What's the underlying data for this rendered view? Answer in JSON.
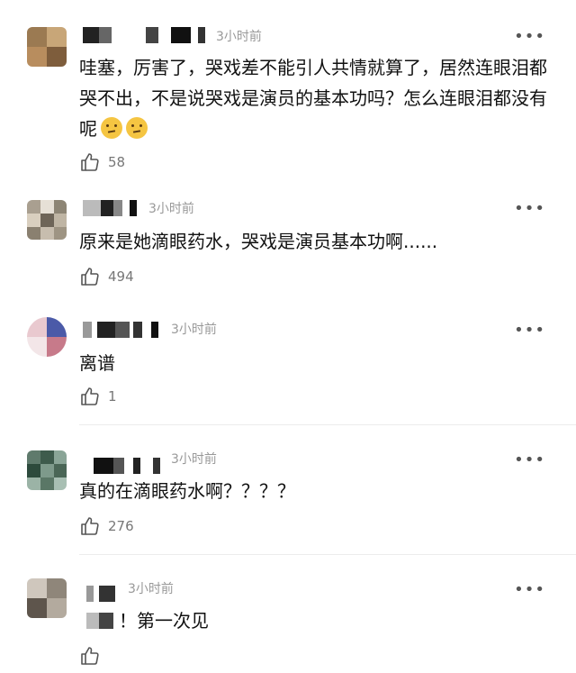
{
  "comments": [
    {
      "time": "3小时前",
      "text": "哇塞，厉害了，哭戏差不能引人共情就算了，居然连眼泪都哭不出，不是说哭戏是演员的基本功吗？怎么连眼泪都没有呢",
      "emojis": [
        "thinking-emoji",
        "thinking-emoji"
      ],
      "likes": "58"
    },
    {
      "time": "3小时前",
      "text": "原来是她滴眼药水，哭戏是演员基本功啊......",
      "likes": "494"
    },
    {
      "time": "3小时前",
      "text": "离谱",
      "likes": "1"
    },
    {
      "time": "3小时前",
      "text": "真的在滴眼药水啊？？？？",
      "likes": "276"
    },
    {
      "time": "3小时前",
      "text": "！第一次见",
      "likes": ""
    }
  ],
  "icons": {
    "more": "more-dots-icon",
    "like": "thumbs-up-icon"
  },
  "more_glyph": "•••"
}
